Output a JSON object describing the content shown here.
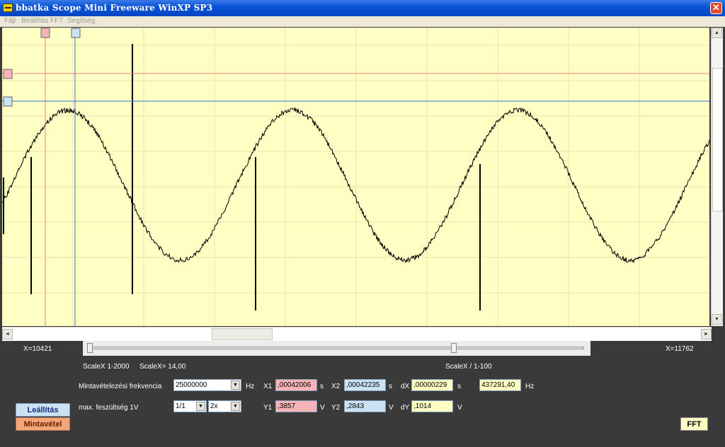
{
  "window": {
    "title": "bbatka Scope Mini Freeware WinXP SP3",
    "close_glyph": "✕"
  },
  "menu": [
    {
      "label": "Fájl"
    },
    {
      "label": "Beállítás"
    },
    {
      "label": "FFT"
    },
    {
      "label": "Segítség"
    }
  ],
  "plot": {
    "background": "#ffffc3",
    "grid_color": "#ecdfb0",
    "trace_color": "#000000",
    "cursor1_color": "#f08080",
    "cursor2_color": "#5a8ad8",
    "cursor1_marker_color": "#f6b3b8",
    "cursor2_marker_color": "#c9e3f5"
  },
  "scroll": {
    "up_glyph": "▲",
    "down_glyph": "▼",
    "left_glyph": "◄",
    "right_glyph": "►"
  },
  "status": {
    "x_left": "X=10421",
    "x_right": "X=11762",
    "scalex_range": "ScaleX 1-2000",
    "scalex_value": "ScaleX= 14,00",
    "scalex_div": "ScaleX / 1-100"
  },
  "controls": {
    "sample_freq_label": "Mintavételezési frekvencia",
    "sample_freq_value": "25000000",
    "sample_freq_unit": "Hz",
    "max_voltage_label": "max. feszültség  1V",
    "divider_value": "1/1",
    "gain_value": "2x",
    "x1_label": "X1",
    "x1_value": ",00042006",
    "x1_unit": "s",
    "x2_label": "X2",
    "x2_value": ",00042235",
    "x2_unit": "s",
    "dx_label": "dX",
    "dx_value": ",00000229",
    "dx_unit": "s",
    "freq_value": "437291,40",
    "freq_unit": "Hz",
    "y1_label": "Y1",
    "y1_value": ",3857",
    "y1_unit": "V",
    "y2_label": "Y2",
    "y2_value": ",2843",
    "y2_unit": "V",
    "dy_label": "dY",
    "dy_value": ",1014",
    "dy_unit": "V",
    "stop_button": "Leállítás",
    "sample_button": "Mintavétel",
    "fft_button": "FFT",
    "dropdown_glyph": "▼"
  }
}
